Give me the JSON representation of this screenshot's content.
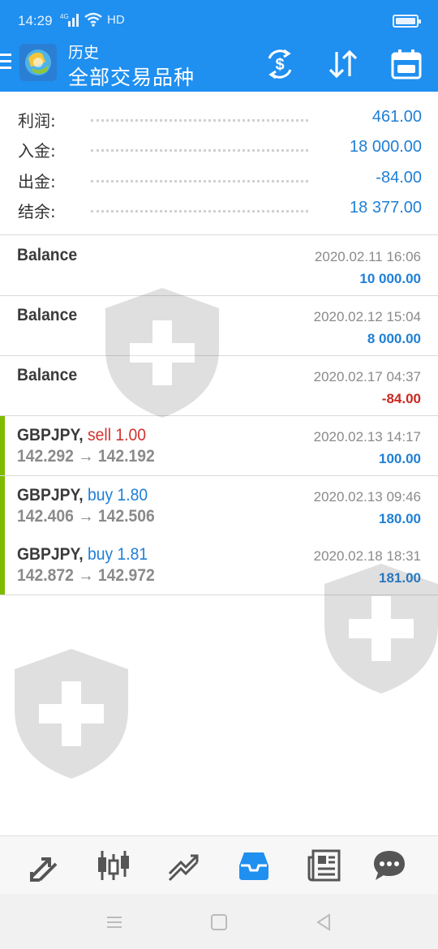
{
  "status_bar": {
    "time": "14:29",
    "network": "4G",
    "hd": "HD"
  },
  "header": {
    "subtitle": "历史",
    "title": "全部交易品种",
    "actions": [
      "currency-exchange-icon",
      "sort-icon",
      "calendar-icon"
    ]
  },
  "summary": {
    "rows": [
      {
        "label": "利润:",
        "value": "461.00"
      },
      {
        "label": "入金:",
        "value": "18 000.00"
      },
      {
        "label": "出金:",
        "value": "-84.00"
      },
      {
        "label": "结余:",
        "value": "18 377.00"
      }
    ]
  },
  "deals": [
    {
      "kind": "balance",
      "title": "Balance",
      "time": "2020.02.11 16:06",
      "profit": "10 000.00",
      "sign": "pos"
    },
    {
      "kind": "balance",
      "title": "Balance",
      "time": "2020.02.12 15:04",
      "profit": "8 000.00",
      "sign": "pos"
    },
    {
      "kind": "balance",
      "title": "Balance",
      "time": "2020.02.17 04:37",
      "profit": "-84.00",
      "sign": "neg"
    },
    {
      "kind": "trade",
      "symbol": "GBPJPY,",
      "side": "sell 1.00",
      "side_type": "sell",
      "prices": "142.292 → 142.192",
      "time": "2020.02.13 14:17",
      "profit": "100.00",
      "sign": "pos"
    },
    {
      "kind": "trade",
      "symbol": "GBPJPY,",
      "side": "buy 1.80",
      "side_type": "buy",
      "prices": "142.406 → 142.506",
      "time": "2020.02.13 09:46",
      "profit": "180.00",
      "sign": "pos"
    },
    {
      "kind": "trade",
      "symbol": "GBPJPY,",
      "side": "buy 1.81",
      "side_type": "buy",
      "prices": "142.872 → 142.972",
      "time": "2020.02.18 18:31",
      "profit": "181.00",
      "sign": "pos"
    }
  ],
  "bottom_nav": {
    "items": [
      "quotes-icon",
      "chart-icon",
      "trade-icon",
      "history-icon",
      "news-icon",
      "chat-icon"
    ],
    "active": "history-icon",
    "active_color": "#1f8ff0",
    "inactive_color": "#555555"
  },
  "colors": {
    "header": "#1f8ff0",
    "positive": "#1f7fd6",
    "negative": "#c8281f",
    "trade_accent": "#7fba00"
  }
}
